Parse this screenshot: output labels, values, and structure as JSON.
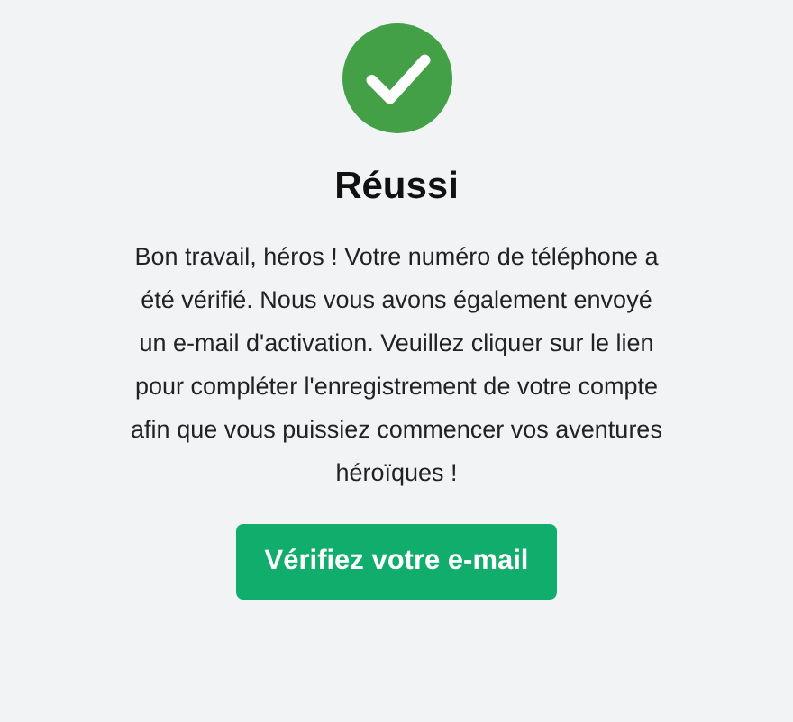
{
  "title": "Réussi",
  "message": "Bon travail, héros ! Votre numéro de téléphone a été vérifié. Nous vous avons également envoyé un e-mail d'activation. Veuillez cliquer sur le lien pour compléter l'enregistrement de votre compte afin que vous puissiez commencer vos aventures héroïques !",
  "button": {
    "label": "Vérifiez votre e-mail"
  }
}
